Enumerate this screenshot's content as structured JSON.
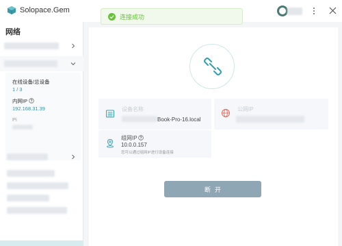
{
  "app": {
    "title": "Solopace.Gem"
  },
  "toast": {
    "message": "连接成功"
  },
  "sidebar": {
    "title": "网络",
    "detail": {
      "online_label": "在线设备/总设备",
      "online_value": "1 / 3",
      "lan_ip_label": "内网IP",
      "lan_ip_value": "192.168.31.39",
      "extra_label": "Pi"
    }
  },
  "main": {
    "device_card": {
      "label": "设备名称",
      "value": "Book-Pro-16.local"
    },
    "public_ip_card": {
      "label": "公网IP"
    },
    "lan_ip_card": {
      "label": "组网IP",
      "value": "10.0.0.157",
      "hint": "您可以通过组网IP进行设备连接"
    },
    "disconnect_label": "断开"
  },
  "colors": {
    "accent": "#3a8ea0",
    "success": "#67c23a",
    "button": "#8fa6b5"
  }
}
